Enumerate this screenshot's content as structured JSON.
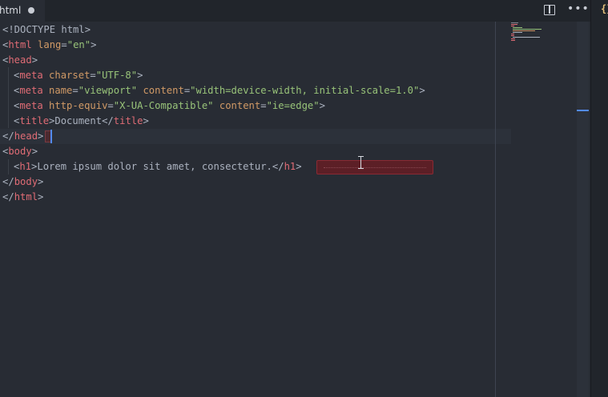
{
  "tab": {
    "label": "html"
  },
  "side_icon": "{}",
  "more_icon": "•••",
  "code": {
    "line1": {
      "a": "<!DOCTYPE html>"
    },
    "line2": {
      "open": "<",
      "tag": "html",
      "attr": " lang",
      "eq": "=",
      "str": "\"en\"",
      "close": ">"
    },
    "line3": {
      "open": "<",
      "tag": "head",
      "close": ">"
    },
    "line4": {
      "open": "<",
      "tag": "meta",
      "attr": " charset",
      "eq": "=",
      "str": "\"UTF-8\"",
      "close": ">"
    },
    "line5": {
      "open": "<",
      "tag": "meta",
      "attr1": " name",
      "eq1": "=",
      "str1": "\"viewport\"",
      "attr2": " content",
      "eq2": "=",
      "str2": "\"width=device-width, initial-scale=1.0\"",
      "close": ">"
    },
    "line6": {
      "open": "<",
      "tag": "meta",
      "attr1": " http-equiv",
      "eq1": "=",
      "str1": "\"X-UA-Compatible\"",
      "attr2": " content",
      "eq2": "=",
      "str2": "\"ie=edge\"",
      "close": ">"
    },
    "line7": {
      "open": "<",
      "tag": "title",
      "close": ">",
      "text": "Document",
      "open2": "</",
      "tag2": "title",
      "close2": ">"
    },
    "line8": {
      "open": "</",
      "tag": "head",
      "close": ">"
    },
    "line9": {
      "open": "<",
      "tag": "body",
      "close": ">"
    },
    "line10": {
      "open": "<",
      "tag": "h1",
      "close": ">",
      "text": "Lorem ipsum dolor sit amet, consectetur.",
      "open2": "</",
      "tag2": "h1",
      "close2": ">"
    },
    "line11": {
      "open": "</",
      "tag": "body",
      "close": ">"
    },
    "line12": {
      "open": "</",
      "tag": "html",
      "close": ">"
    }
  },
  "colors": {
    "background": "#282c34",
    "tag": "#e06c75",
    "attribute": "#d19a66",
    "string": "#98c379",
    "text": "#abb2bf",
    "cursor": "#528bff"
  }
}
